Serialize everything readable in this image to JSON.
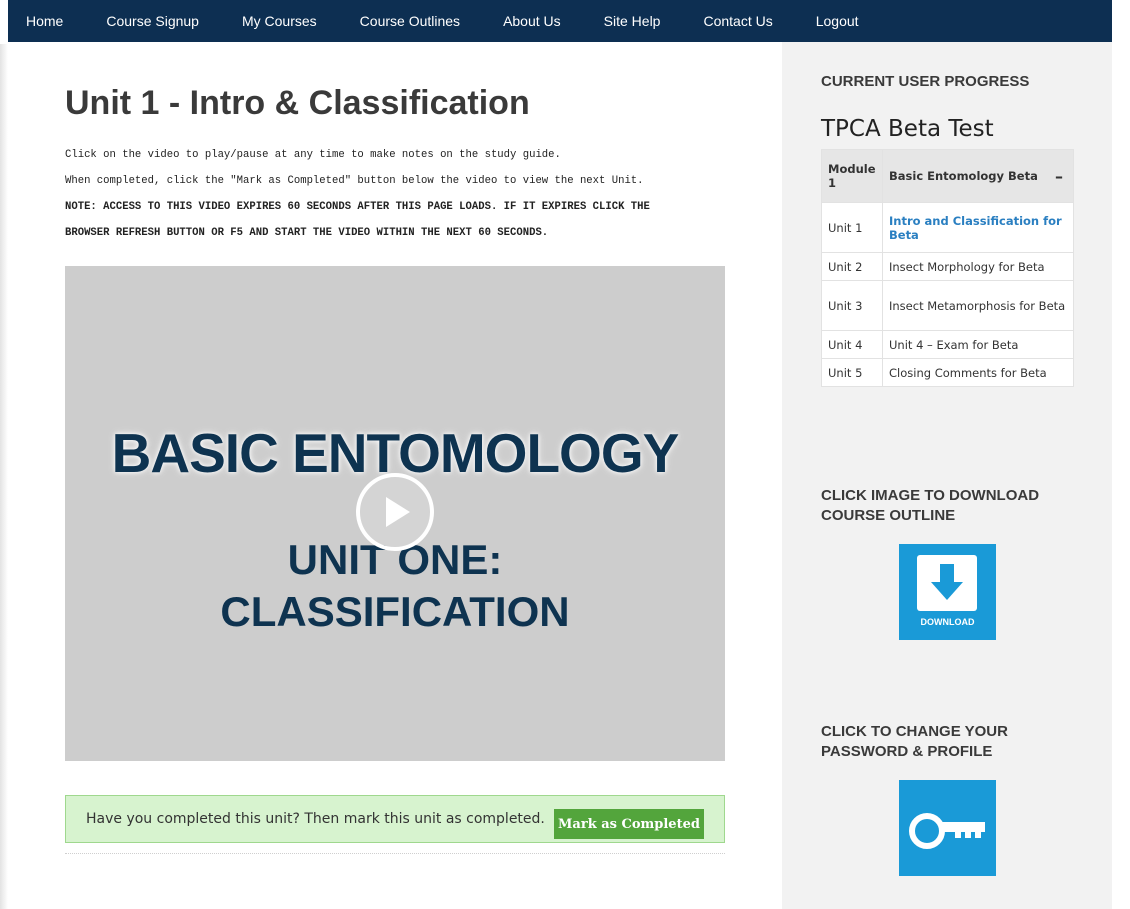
{
  "nav": {
    "items": [
      "Home",
      "Course Signup",
      "My Courses",
      "Course Outlines",
      "About Us",
      "Site Help",
      "Contact Us",
      "Logout"
    ]
  },
  "main": {
    "title": "Unit 1 - Intro & Classification",
    "instructions": [
      "Click on the video to play/pause at any time to make notes on the study guide.",
      "When completed, click the \"Mark as Completed\" button below the video to view the next Unit."
    ],
    "note_line1": "NOTE: ACCESS TO THIS VIDEO EXPIRES 60 SECONDS AFTER THIS PAGE LOADS.  IF IT EXPIRES CLICK THE",
    "note_line2": "BROWSER REFRESH BUTTON OR F5 AND START THE VIDEO WITHIN THE NEXT 60 SECONDS.",
    "video": {
      "title": "BASIC ENTOMOLOGY",
      "subtitle_line1": "UNIT ONE:",
      "subtitle_line2": "CLASSIFICATION"
    },
    "completion": {
      "text": "Have you completed this unit? Then mark this unit as completed.",
      "button_label": "Mark as Completed"
    }
  },
  "sidebar": {
    "progress_heading": "CURRENT USER PROGRESS",
    "course_name": "TPCA Beta Test",
    "module": {
      "label": "Module 1",
      "title": "Basic Entomology Beta",
      "toggle": "–"
    },
    "units": [
      {
        "unit": "Unit 1",
        "title": "Intro and Classification for Beta",
        "current": true
      },
      {
        "unit": "Unit 2",
        "title": "Insect Morphology for Beta",
        "current": false
      },
      {
        "unit": "Unit 3",
        "title": "Insect Metamorphosis for Beta",
        "current": false
      },
      {
        "unit": "Unit 4",
        "title": "Unit 4 – Exam for Beta",
        "current": false
      },
      {
        "unit": "Unit 5",
        "title": "Closing Comments for Beta",
        "current": false
      }
    ],
    "download_heading_line1": "CLICK IMAGE TO DOWNLOAD",
    "download_heading_line2": "COURSE OUTLINE",
    "download_label": "DOWNLOAD",
    "password_heading_line1": "CLICK TO CHANGE YOUR",
    "password_heading_line2": "PASSWORD & PROFILE"
  },
  "colors": {
    "nav_bg": "#0d2f52",
    "video_bg": "#cdcdcd",
    "completion_bg": "#d7f3cf",
    "button_green": "#53a53c",
    "icon_blue": "#1a9ad7",
    "link_blue": "#2a7fc1"
  },
  "icons": [
    "play-icon",
    "download-icon",
    "key-icon"
  ]
}
